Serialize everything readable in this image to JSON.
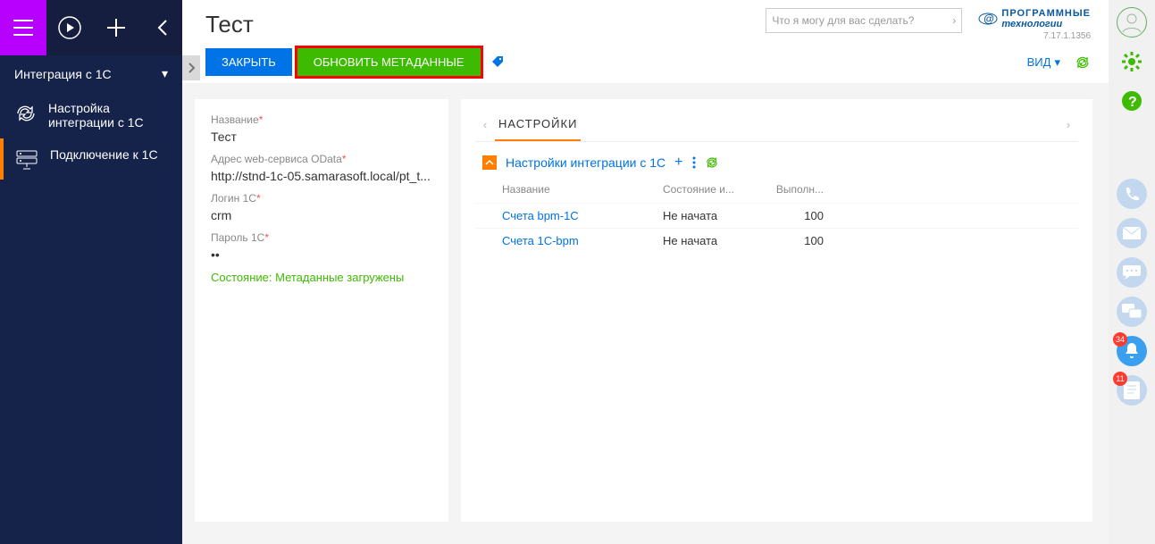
{
  "topbar": {},
  "sidebar": {
    "section": "Интеграция с 1С",
    "items": [
      {
        "label": "Настройка интеграции с 1С"
      },
      {
        "label": "Подключение к 1С"
      }
    ]
  },
  "header": {
    "title": "Тест",
    "search_placeholder": "Что я могу для вас сделать?",
    "logo_top": "ПРОГРАММНЫЕ",
    "logo_bottom": "технологии",
    "version": "7.17.1.1356",
    "close_btn": "ЗАКРЫТЬ",
    "refresh_btn": "ОБНОВИТЬ МЕТАДАННЫЕ",
    "view_label": "ВИД"
  },
  "form": {
    "name_label": "Название",
    "name_value": "Тест",
    "odata_label": "Адрес web-сервиса OData",
    "odata_value": "http://stnd-1c-05.samarasoft.local/pt_t...",
    "login_label": "Логин 1C",
    "login_value": "crm",
    "password_label": "Пароль 1C",
    "password_value": "••",
    "status_text": "Состояние: Метаданные загружены"
  },
  "detail": {
    "tab_label": "НАСТРОЙКИ",
    "title": "Настройки интеграции с 1С",
    "col_name": "Название",
    "col_state": "Состояние и...",
    "col_exec": "Выполн...",
    "rows": [
      {
        "name": "Счета bpm-1C",
        "state": "Не начата",
        "exec": "100"
      },
      {
        "name": "Счета 1C-bpm",
        "state": "Не начата",
        "exec": "100"
      }
    ]
  },
  "rail": {
    "notif_count": "34",
    "feed_count": "11"
  }
}
